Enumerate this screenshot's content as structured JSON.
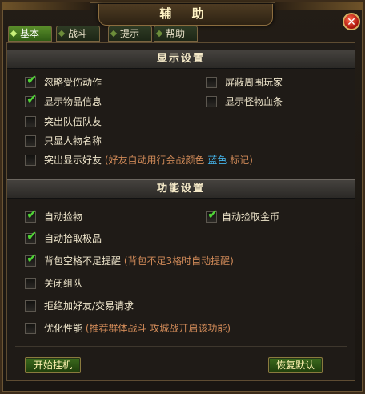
{
  "window": {
    "title": "辅 助",
    "close_label": "✕"
  },
  "tabs": [
    {
      "label": "基本",
      "active": true
    },
    {
      "label": "战斗",
      "active": false
    },
    {
      "label": "提示",
      "active": false
    },
    {
      "label": "帮助",
      "active": false
    }
  ],
  "display": {
    "title": "显示设置",
    "options": {
      "ignore_hit": {
        "label": "忽略受伤动作",
        "checked": true
      },
      "block_players": {
        "label": "屏蔽周围玩家",
        "checked": false
      },
      "show_item_info": {
        "label": "显示物品信息",
        "checked": true
      },
      "show_monster_hp": {
        "label": "显示怪物血条",
        "checked": false
      },
      "highlight_team": {
        "label": "突出队伍队友",
        "checked": false
      },
      "names_only": {
        "label": "只显人物名称",
        "checked": false
      },
      "highlight_friends": {
        "label": "突出显示好友",
        "checked": false,
        "note_a": "(好友自动用行会战颜色",
        "note_blue": "蓝色",
        "note_b": "标记)"
      }
    }
  },
  "function": {
    "title": "功能设置",
    "options": {
      "auto_loot": {
        "label": "自动捡物",
        "checked": true
      },
      "auto_gold": {
        "label": "自动捡取金币",
        "checked": true
      },
      "auto_best": {
        "label": "自动拾取极品",
        "checked": true
      },
      "bag_full": {
        "label": "背包空格不足提醒",
        "checked": true,
        "note": "(背包不足3格时自动提醒)"
      },
      "close_team": {
        "label": "关闭组队",
        "checked": false
      },
      "refuse_req": {
        "label": "拒绝加好友/交易请求",
        "checked": false
      },
      "optimize": {
        "label": "优化性能",
        "checked": false,
        "note": "(推荐群体战斗 攻城战开启该功能)"
      }
    }
  },
  "buttons": {
    "start": "开始挂机",
    "restore": "恢复默认"
  },
  "colors": {
    "check": "#4fd335",
    "note": "#d08a58",
    "highlight": "#45b3e8",
    "accent": "#3c6b1d"
  }
}
